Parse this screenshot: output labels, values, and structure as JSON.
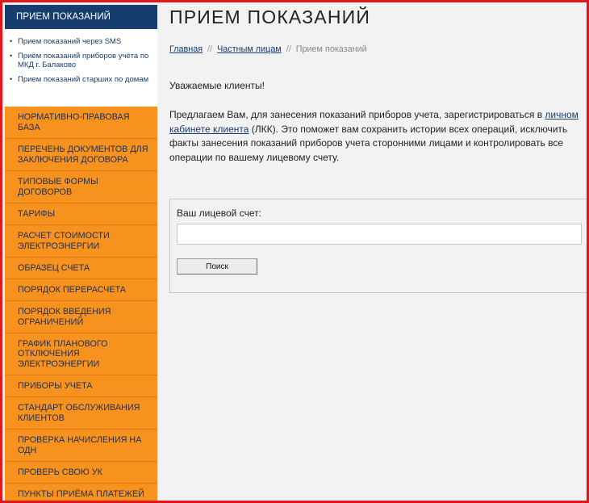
{
  "sidebar": {
    "header": "ПРИЕМ ПОКАЗАНИЙ",
    "bullet": "•",
    "sub_items": [
      "Прием показаний через SMS",
      "Приём показаний приборов учёта по МКД г. Балаково",
      "Прием показаний старших по домам"
    ],
    "nav_items": [
      "НОРМАТИВНО-ПРАВОВАЯ БАЗА",
      "ПЕРЕЧЕНЬ ДОКУМЕНТОВ ДЛЯ ЗАКЛЮЧЕНИЯ ДОГОВОРА",
      "ТИПОВЫЕ ФОРМЫ ДОГОВОРОВ",
      "ТАРИФЫ",
      "РАСЧЕТ СТОИМОСТИ ЭЛЕКТРОЭНЕРГИИ",
      "ОБРАЗЕЦ СЧЕТА",
      "ПОРЯДОК ПЕРЕРАСЧЕТА",
      "ПОРЯДОК ВВЕДЕНИЯ ОГРАНИЧЕНИЙ",
      "ГРАФИК ПЛАНОВОГО ОТКЛЮЧЕНИЯ ЭЛЕКТРОЭНЕРГИИ",
      "ПРИБОРЫ УЧЕТА",
      "СТАНДАРТ ОБСЛУЖИВАНИЯ КЛИЕНТОВ",
      "ПРОВЕРКА НАЧИСЛЕНИЯ НА ОДН",
      "ПРОВЕРЬ СВОЮ УК",
      "ПУНКТЫ ПРИЁМА ПЛАТЕЖЕЙ"
    ]
  },
  "main": {
    "title": "ПРИЕМ ПОКАЗАНИЙ",
    "breadcrumb": {
      "home": "Главная",
      "separator": "//",
      "section": "Частным лицам",
      "current": "Прием показаний"
    },
    "greeting": "Уважаемые клиенты!",
    "paragraph": {
      "before_link": "Предлагаем Вам, для занесения показаний приборов учета, зарегистрироваться в ",
      "link": "личном кабинете клиента",
      "after_link": " (ЛКК). Это поможет вам сохранить истории всех операций, исключить факты занесения показаний приборов учета сторонними лицами и контролировать все операции по вашему лицевому счету."
    },
    "form": {
      "label": "Ваш лицевой счет:",
      "input_value": "",
      "button_label": "Поиск"
    }
  },
  "colors": {
    "frame_border": "#e3161b",
    "header_blue": "#173c6e",
    "nav_orange": "#f7921e",
    "page_background": "#f2f2f2"
  }
}
